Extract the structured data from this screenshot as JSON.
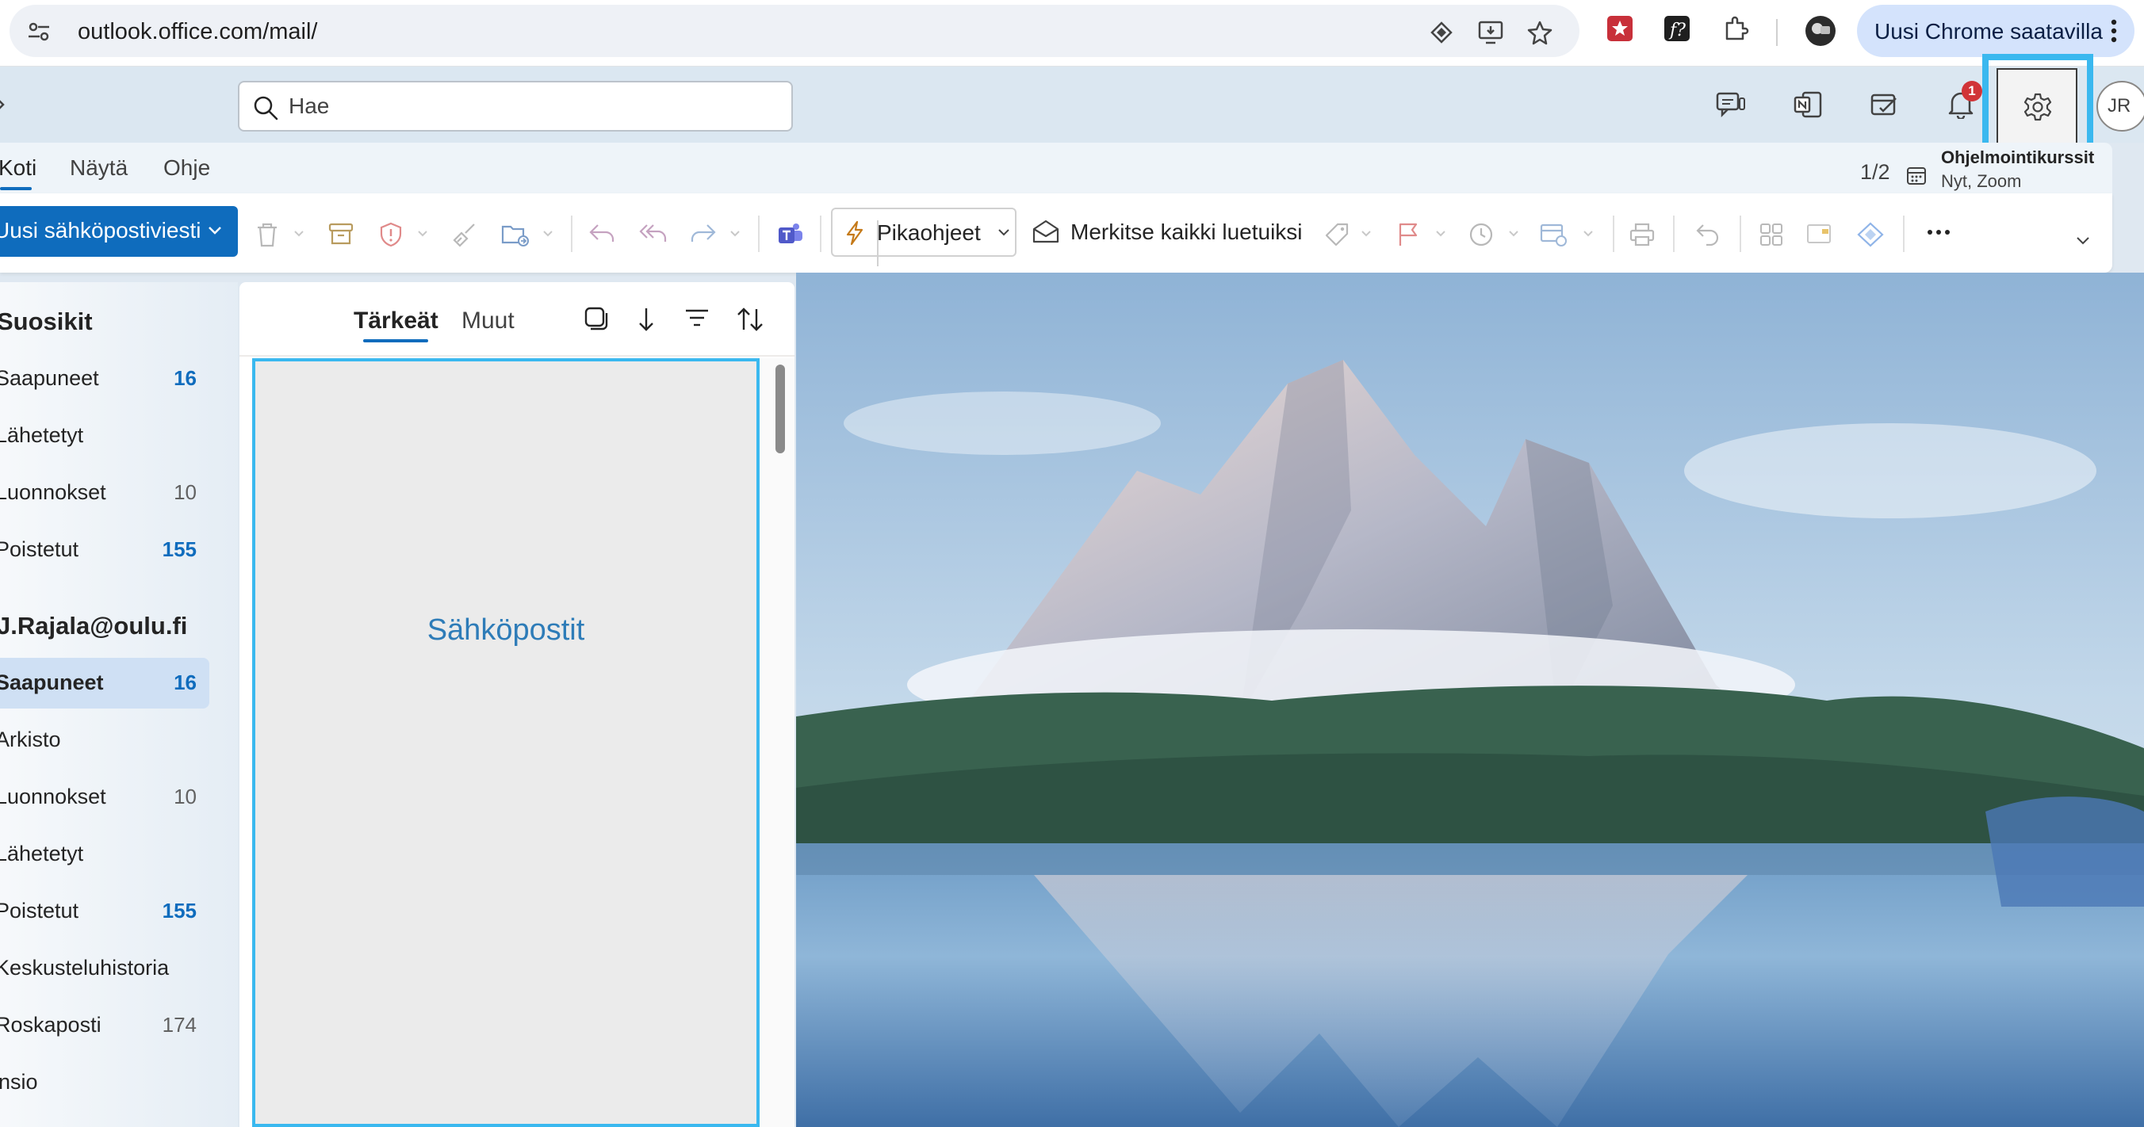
{
  "browser": {
    "url": "outlook.office.com/mail/",
    "update_button_label": "Uusi Chrome saatavilla"
  },
  "header": {
    "search_placeholder": "Hae",
    "notification_count": "1",
    "avatar_initials": "JR",
    "highlight_color": "#3ab8ef"
  },
  "ribbon": {
    "tabs": [
      "Koti",
      "Näytä",
      "Ohje"
    ],
    "new_mail_label": "Uusi sähköpostiviesti",
    "quick_steps_label": "Pikaohjeet",
    "mark_all_read_label": "Merkitse kaikki luetuiksi",
    "reminder": {
      "page": "1/2",
      "title": "Ohjelmointikurssit",
      "subtitle": "Nyt, Zoom"
    }
  },
  "folders": {
    "favorites_header": "Suosikit",
    "favorites": [
      {
        "label": "Saapuneet",
        "count": "16"
      },
      {
        "label": "Lähetetyt",
        "count": ""
      },
      {
        "label": "Luonnokset",
        "count": "10"
      },
      {
        "label": "Poistetut",
        "count": "155"
      }
    ],
    "account_header": "J.Rajala@oulu.fi",
    "account_folders": [
      {
        "label": "Saapuneet",
        "count": "16"
      },
      {
        "label": "Arkisto",
        "count": ""
      },
      {
        "label": "Luonnokset",
        "count": "10"
      },
      {
        "label": "Lähetetyt",
        "count": ""
      },
      {
        "label": "Poistetut",
        "count": "155"
      },
      {
        "label": "Keskusteluhistoria",
        "count": ""
      },
      {
        "label": "Roskaposti",
        "count": "174"
      },
      {
        "label": "Uusi kansio",
        "count": ""
      }
    ]
  },
  "message_list": {
    "focused_tab": "Tärkeät",
    "other_tab": "Muut",
    "placeholder_label": "Sähköpostit"
  }
}
